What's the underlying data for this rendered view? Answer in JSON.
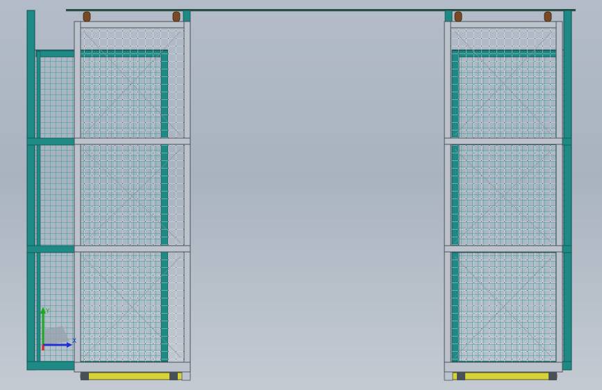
{
  "title": "",
  "colors": {
    "background_top": "#b3bcc8",
    "background_bottom": "#c4cad2",
    "teal_frame": "#1f8a85",
    "teal_dark": "#0e4f4c",
    "teal_mesh": "#2aa39c",
    "steel_frame": "#bcc3cc",
    "steel_dark": "#4a5058",
    "rail": "#2f4c44",
    "track_yellow": "#d6d23a",
    "wheel_brown": "#7a4a24",
    "axis_x": "#1e2fd8",
    "axis_y": "#1fa81f",
    "axis_z": "#d81e1e"
  },
  "triad": {
    "x_label": "X",
    "y_label": "Y",
    "z_label": "Z"
  },
  "components": {
    "top_rail": "overhead-rail",
    "left_fixed_panel": "fixed-teal-mesh-panel",
    "left_sliding_door": "sliding-steel-mesh-door",
    "right_sliding_door": "sliding-steel-mesh-door",
    "right_fixed_panel": "fixed-teal-mesh-panel"
  }
}
